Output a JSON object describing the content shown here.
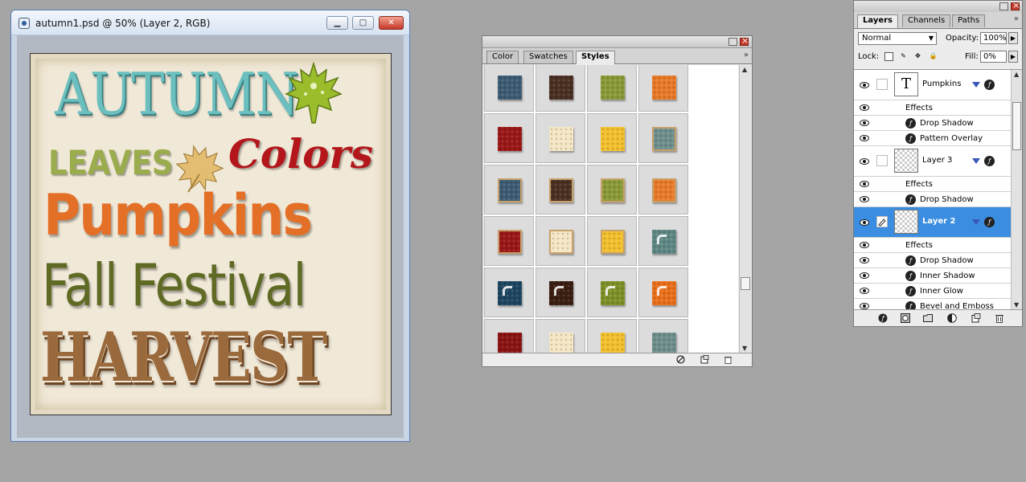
{
  "document": {
    "title": "autumn1.psd @ 50% (Layer 2, RGB)",
    "buttons": {
      "minimize": "▁",
      "maximize": "□",
      "close": "✕"
    },
    "artwork_words": {
      "autumn": "AUTUMN",
      "leaves": "LEAVES",
      "colors": "Colors",
      "pumpkins": "Pumpkins",
      "fall_festival": "Fall Festival",
      "harvest": "HARVEST"
    }
  },
  "styles_panel": {
    "tabs": [
      "Color",
      "Swatches",
      "Styles"
    ],
    "active_tab": "Styles",
    "menu_glyph": "»",
    "swatch_rows": [
      [
        {
          "color": "#3d5c73",
          "variant": "plain"
        },
        {
          "color": "#4a3023",
          "variant": "plain"
        },
        {
          "color": "#8a9a38",
          "variant": "plain"
        },
        {
          "color": "#e87a2a",
          "variant": "plain"
        }
      ],
      [
        {
          "color": "#9a1818",
          "variant": "plain"
        },
        {
          "color": "#f4e6c4",
          "variant": "plain"
        },
        {
          "color": "#f2c02e",
          "variant": "plain"
        },
        {
          "color": "#6f8f8c",
          "variant": "bordered"
        }
      ],
      [
        {
          "color": "#3d5c73",
          "variant": "bordered"
        },
        {
          "color": "#4a3023",
          "variant": "bordered"
        },
        {
          "color": "#8a9a38",
          "variant": "bordered"
        },
        {
          "color": "#e87a2a",
          "variant": "bordered"
        }
      ],
      [
        {
          "color": "#9a1818",
          "variant": "bordered"
        },
        {
          "color": "#f4e6c4",
          "variant": "bordered"
        },
        {
          "color": "#f2c02e",
          "variant": "bordered"
        },
        {
          "color": "#5f8784",
          "variant": "glossy"
        }
      ],
      [
        {
          "color": "#1f4660",
          "variant": "glossy"
        },
        {
          "color": "#3a1e12",
          "variant": "glossy"
        },
        {
          "color": "#7d9028",
          "variant": "glossy"
        },
        {
          "color": "#e8701c",
          "variant": "glossy"
        }
      ],
      [
        {
          "color": "#8a1414",
          "variant": "plain"
        },
        {
          "color": "#f4e6c4",
          "variant": "plain"
        },
        {
          "color": "#f2c02e",
          "variant": "plain"
        },
        {
          "color": "#6f8f8c",
          "variant": "plain"
        }
      ]
    ]
  },
  "layers_panel": {
    "tabs": [
      "Layers",
      "Channels",
      "Paths"
    ],
    "active_tab": "Layers",
    "blend_mode": "Normal",
    "opacity_label": "Opacity:",
    "opacity_value": "100%",
    "lock_label": "Lock:",
    "fill_label": "Fill:",
    "fill_value": "0%",
    "layers": [
      {
        "name": "Pumpkins",
        "kind": "text",
        "thumb_glyph": "T",
        "selected": false,
        "effects_label": "Effects",
        "effects": [
          "Drop Shadow",
          "Pattern Overlay"
        ]
      },
      {
        "name": "Layer 3",
        "kind": "pixel",
        "selected": false,
        "effects_label": "Effects",
        "effects": [
          "Drop Shadow"
        ]
      },
      {
        "name": "Layer 2",
        "kind": "pixel",
        "selected": true,
        "effects_label": "Effects",
        "effects": [
          "Drop Shadow",
          "Inner Shadow",
          "Inner Glow",
          "Bevel and Emboss"
        ]
      }
    ],
    "fx_glyph": "ƒ"
  }
}
